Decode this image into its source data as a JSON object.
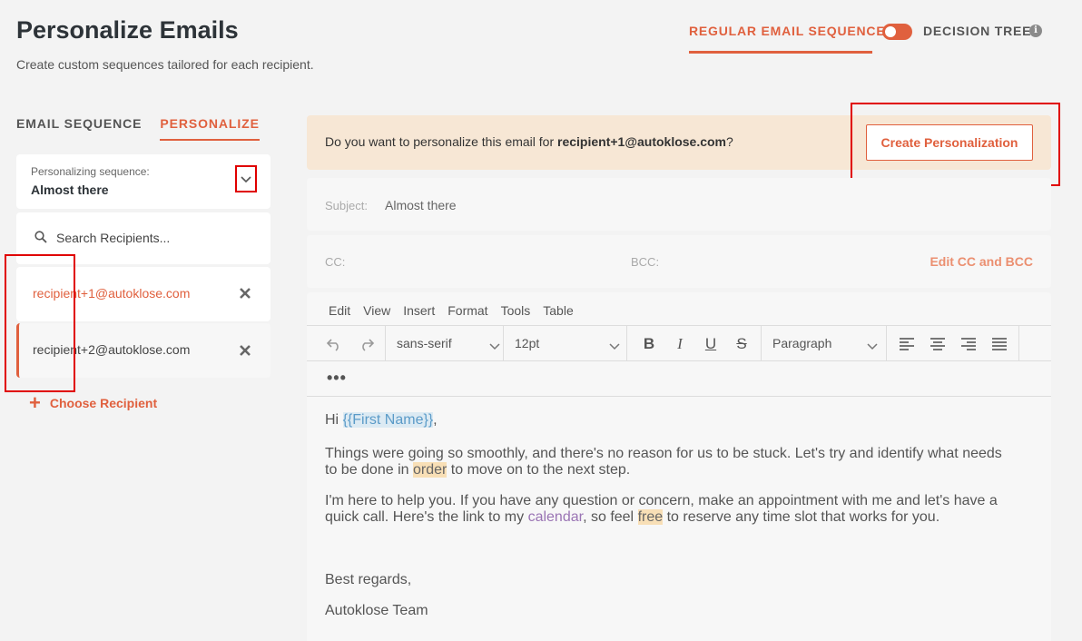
{
  "page": {
    "title": "Personalize Emails",
    "subtitle": "Create custom sequences tailored for each recipient."
  },
  "mode": {
    "regular_label": "REGULAR EMAIL SEQUENCE",
    "tree_label": "DECISION TREE",
    "info_glyph": "i",
    "toggle_on": true,
    "accent_color": "#e0603e"
  },
  "left_tabs": [
    {
      "label": "EMAIL SEQUENCE",
      "active": false
    },
    {
      "label": "PERSONALIZE",
      "active": true
    }
  ],
  "sequence": {
    "label": "Personalizing sequence:",
    "value": "Almost there"
  },
  "search": {
    "placeholder": "Search Recipients..."
  },
  "recipients": [
    {
      "email": "recipient+1@autoklose.com",
      "selected": true
    },
    {
      "email": "recipient+2@autoklose.com",
      "selected": false
    }
  ],
  "choose_recipient": {
    "plus": "+",
    "label": "Choose Recipient"
  },
  "prompt": {
    "text_before": "Do you want to personalize this email for ",
    "email": "recipient+1@autoklose.com",
    "text_after": "?",
    "button_label": "Create Personalization"
  },
  "subject": {
    "label": "Subject:",
    "value": "Almost there"
  },
  "cc": {
    "cc_label": "CC:",
    "bcc_label": "BCC:",
    "edit_label": "Edit CC and BCC"
  },
  "editor": {
    "menu": [
      "Edit",
      "View",
      "Insert",
      "Format",
      "Tools",
      "Table"
    ],
    "font_family": "sans-serif",
    "font_size": "12pt",
    "block_format": "Paragraph",
    "more_label": "•••",
    "body": {
      "greeting_prefix": "Hi ",
      "merge_tag": "{{First Name}}",
      "greeting_suffix": ",",
      "p1_a": "Things were going so smoothly, and there's no reason for us to be stuck. Let's try and identify what needs to be done in ",
      "p1_hl": "order",
      "p1_b": " to move on to the next step.",
      "p2_a": "I'm here to help you. If you have any question or concern, make an appointment with me and let's have a quick call. Here's the link to my ",
      "p2_link": "calendar",
      "p2_b": ", so feel ",
      "p2_hl": "free",
      "p2_c": " to reserve any time slot that works for you.",
      "signoff": "Best regards,",
      "signature": "Autoklose Team"
    }
  }
}
